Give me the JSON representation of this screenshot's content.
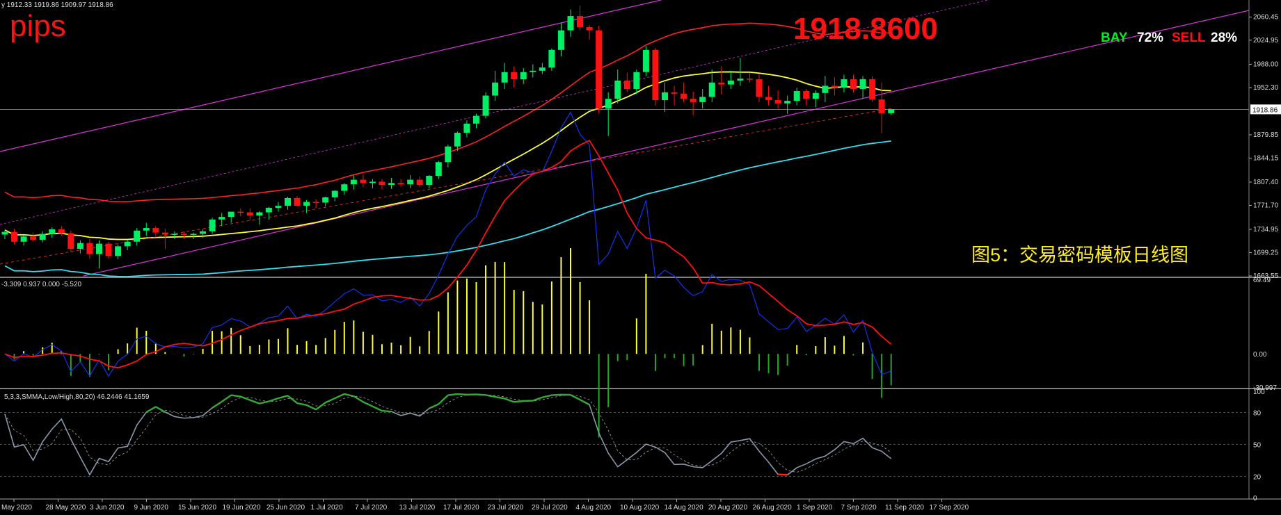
{
  "header": {
    "ohlc_text": "y  1912.33 1919.86 1909.97 1918.86",
    "pips_label": "pips",
    "big_price": "1918.8600",
    "bay_label": "BAY",
    "bay_pct": "72%",
    "sell_label": "SELL",
    "sell_pct": "28%",
    "caption": "图5：交易密码模板日线图",
    "current_price_tag": "1918.86"
  },
  "colors": {
    "bull": "#00ee66",
    "bear": "#ff1111",
    "yellow_ma": "#ffff33",
    "red_ma": "#ff2222",
    "cyan_ma": "#33ddee",
    "channel": "#dd33dd",
    "macd_line": "#1133ee",
    "signal_line": "#ff1111",
    "stoch_main": "#8899aa",
    "stoch_overbought": "#33aa33"
  },
  "chart_data": [
    {
      "type": "candlestick",
      "price_axis_ticks": [
        "2060.45",
        "2024.95",
        "1988.00",
        "1952.30",
        "1918.86",
        "1879.85",
        "1844.15",
        "1807.40",
        "1771.70",
        "1734.95",
        "1699.25",
        "1663.55"
      ],
      "ylim": [
        1663.55,
        2078
      ],
      "date_labels": [
        "May 2020",
        "28 May 2020",
        "3 Jun 2020",
        "9 Jun 2020",
        "15 Jun 2020",
        "19 Jun 2020",
        "25 Jun 2020",
        "1 Jul 2020",
        "7 Jul 2020",
        "13 Jul 2020",
        "17 Jul 2020",
        "23 Jul 2020",
        "29 Jul 2020",
        "4 Aug 2020",
        "10 Aug 2020",
        "14 Aug 2020",
        "20 Aug 2020",
        "26 Aug 2020",
        "1 Sep 2020",
        "7 Sep 2020",
        "11 Sep 2020",
        "17 Sep 2020"
      ],
      "candles": [
        [
          1727,
          1734,
          1720,
          1731
        ],
        [
          1731,
          1736,
          1712,
          1716
        ],
        [
          1716,
          1726,
          1710,
          1724
        ],
        [
          1724,
          1730,
          1716,
          1719
        ],
        [
          1719,
          1732,
          1715,
          1728
        ],
        [
          1728,
          1738,
          1722,
          1735
        ],
        [
          1735,
          1740,
          1725,
          1729
        ],
        [
          1729,
          1733,
          1700,
          1705
        ],
        [
          1705,
          1718,
          1698,
          1714
        ],
        [
          1714,
          1720,
          1690,
          1697
        ],
        [
          1697,
          1718,
          1675,
          1713
        ],
        [
          1713,
          1716,
          1690,
          1694
        ],
        [
          1694,
          1712,
          1689,
          1709
        ],
        [
          1709,
          1718,
          1703,
          1716
        ],
        [
          1716,
          1737,
          1710,
          1733
        ],
        [
          1733,
          1745,
          1725,
          1737
        ],
        [
          1737,
          1740,
          1725,
          1730
        ],
        [
          1730,
          1736,
          1705,
          1727
        ],
        [
          1727,
          1732,
          1720,
          1728
        ],
        [
          1728,
          1732,
          1720,
          1727
        ],
        [
          1727,
          1730,
          1720,
          1728
        ],
        [
          1728,
          1735,
          1722,
          1732
        ],
        [
          1732,
          1753,
          1728,
          1750
        ],
        [
          1750,
          1760,
          1740,
          1754
        ],
        [
          1754,
          1762,
          1745,
          1762
        ],
        [
          1762,
          1767,
          1755,
          1761
        ],
        [
          1761,
          1767,
          1750,
          1756
        ],
        [
          1756,
          1763,
          1742,
          1761
        ],
        [
          1761,
          1769,
          1750,
          1768
        ],
        [
          1768,
          1777,
          1762,
          1771
        ],
        [
          1771,
          1785,
          1765,
          1783
        ],
        [
          1783,
          1786,
          1770,
          1771
        ],
        [
          1771,
          1780,
          1760,
          1777
        ],
        [
          1777,
          1781,
          1768,
          1776
        ],
        [
          1776,
          1785,
          1770,
          1784
        ],
        [
          1784,
          1795,
          1778,
          1794
        ],
        [
          1794,
          1806,
          1788,
          1804
        ],
        [
          1804,
          1818,
          1796,
          1811
        ],
        [
          1811,
          1820,
          1800,
          1806
        ],
        [
          1806,
          1812,
          1798,
          1808
        ],
        [
          1808,
          1812,
          1796,
          1803
        ],
        [
          1803,
          1814,
          1797,
          1806
        ],
        [
          1806,
          1812,
          1800,
          1804
        ],
        [
          1804,
          1818,
          1798,
          1811
        ],
        [
          1811,
          1816,
          1800,
          1803
        ],
        [
          1803,
          1818,
          1798,
          1817
        ],
        [
          1817,
          1840,
          1812,
          1838
        ],
        [
          1838,
          1865,
          1830,
          1862
        ],
        [
          1862,
          1885,
          1855,
          1883
        ],
        [
          1883,
          1902,
          1876,
          1897
        ],
        [
          1897,
          1912,
          1890,
          1909
        ],
        [
          1909,
          1945,
          1905,
          1940
        ],
        [
          1940,
          1978,
          1932,
          1960
        ],
        [
          1960,
          1990,
          1950,
          1976
        ],
        [
          1976,
          1985,
          1952,
          1965
        ],
        [
          1965,
          1982,
          1958,
          1976
        ],
        [
          1976,
          1988,
          1968,
          1978
        ],
        [
          1978,
          1990,
          1973,
          1983
        ],
        [
          1983,
          2012,
          1978,
          2010
        ],
        [
          2010,
          2052,
          2000,
          2040
        ],
        [
          2040,
          2072,
          2030,
          2062
        ],
        [
          2062,
          2078,
          2040,
          2045
        ],
        [
          2045,
          2048,
          2026,
          2040
        ],
        [
          2040,
          2047,
          1913,
          1920
        ],
        [
          1920,
          1945,
          1878,
          1935
        ],
        [
          1935,
          1980,
          1928,
          1963
        ],
        [
          1963,
          1975,
          1945,
          1950
        ],
        [
          1950,
          1980,
          1942,
          1976
        ],
        [
          1976,
          2016,
          1970,
          2010
        ],
        [
          2010,
          2013,
          1925,
          1933
        ],
        [
          1933,
          1960,
          1915,
          1945
        ],
        [
          1945,
          1955,
          1925,
          1943
        ],
        [
          1943,
          1960,
          1930,
          1935
        ],
        [
          1935,
          1946,
          1910,
          1930
        ],
        [
          1930,
          1950,
          1920,
          1938
        ],
        [
          1938,
          1980,
          1930,
          1960
        ],
        [
          1960,
          1985,
          1942,
          1957
        ],
        [
          1957,
          1978,
          1950,
          1963
        ],
        [
          1963,
          1998,
          1955,
          1966
        ],
        [
          1966,
          1975,
          1960,
          1965
        ],
        [
          1965,
          1973,
          1930,
          1938
        ],
        [
          1938,
          1955,
          1925,
          1933
        ],
        [
          1933,
          1948,
          1920,
          1928
        ],
        [
          1928,
          1940,
          1912,
          1932
        ],
        [
          1932,
          1952,
          1925,
          1947
        ],
        [
          1947,
          1950,
          1925,
          1935
        ],
        [
          1935,
          1948,
          1922,
          1944
        ],
        [
          1944,
          1970,
          1930,
          1955
        ],
        [
          1955,
          1968,
          1940,
          1952
        ],
        [
          1952,
          1972,
          1945,
          1965
        ],
        [
          1965,
          1972,
          1945,
          1950
        ],
        [
          1950,
          1970,
          1935,
          1965
        ],
        [
          1965,
          1970,
          1930,
          1934
        ],
        [
          1934,
          1960,
          1882,
          1913
        ],
        [
          1913,
          1919,
          1910,
          1918.86
        ]
      ]
    },
    {
      "type": "bar+line",
      "name": "MACD",
      "header_text": "-3.309 0.937 0.000 -5.520",
      "axis_ticks": [
        "69.49",
        "0.00",
        "-30.997"
      ],
      "ylim": [
        -30.997,
        69.49
      ]
    },
    {
      "type": "line",
      "name": "Stochastic",
      "header_text": "5,3,3,SMMA,Low/High,80,20) 46.2446 41.1659",
      "axis_ticks": [
        "100",
        "80",
        "50",
        "20",
        "0"
      ],
      "ylim": [
        0,
        100
      ]
    }
  ]
}
